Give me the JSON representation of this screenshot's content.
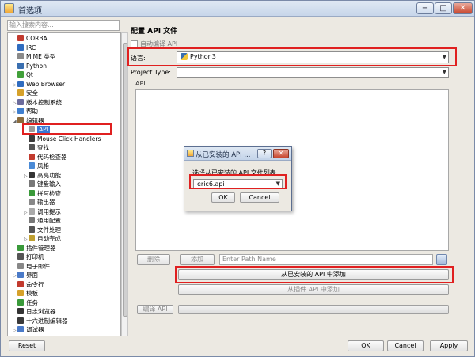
{
  "window": {
    "title": "首选项",
    "min": "−",
    "max": "□",
    "close": "✕"
  },
  "sidebar": {
    "search_placeholder": "输入搜索内容...",
    "items": [
      {
        "label": "CORBA",
        "indent": 1,
        "icon_color": "#c23a2e"
      },
      {
        "label": "IRC",
        "indent": 1,
        "icon_color": "#2f6cc0"
      },
      {
        "label": "MIME 类型",
        "indent": 1,
        "icon_color": "#8a8a8a"
      },
      {
        "label": "Python",
        "indent": 1,
        "icon_color": "#3a6fb0"
      },
      {
        "label": "Qt",
        "indent": 1,
        "icon_color": "#41a03a"
      },
      {
        "label": "Web Browser",
        "indent": 1,
        "arrow": "▷",
        "icon_color": "#2f6cc0"
      },
      {
        "label": "安全",
        "indent": 1,
        "icon_color": "#d6a12a"
      },
      {
        "label": "版本控制系统",
        "indent": 1,
        "arrow": "▷",
        "icon_color": "#6b6b9c"
      },
      {
        "label": "帮助",
        "indent": 1,
        "arrow": "▷",
        "icon_color": "#3f7fcf"
      },
      {
        "label": "编辑器",
        "indent": 1,
        "arrow": "◢",
        "icon_color": "#8a6b3c"
      },
      {
        "label": "API",
        "indent": 2,
        "icon_color": "#9a9a9a",
        "selected": true
      },
      {
        "label": "Mouse Click Handlers",
        "indent": 2,
        "icon_color": "#3a3a3a"
      },
      {
        "label": "查找",
        "indent": 2,
        "icon_color": "#555555"
      },
      {
        "label": "代码检查器",
        "indent": 2,
        "icon_color": "#c23a2e"
      },
      {
        "label": "风格",
        "indent": 2,
        "icon_color": "#4a8ad6"
      },
      {
        "label": "高亮功能",
        "indent": 2,
        "arrow": "▷",
        "icon_color": "#333333"
      },
      {
        "label": "键盘输入",
        "indent": 2,
        "icon_color": "#777777"
      },
      {
        "label": "拼写检查",
        "indent": 2,
        "icon_color": "#3a9a3a"
      },
      {
        "label": "输出器",
        "indent": 2,
        "icon_color": "#888888"
      },
      {
        "label": "调用提示",
        "indent": 2,
        "arrow": "▷",
        "icon_color": "#aaaaaa"
      },
      {
        "label": "通用配置",
        "indent": 2,
        "icon_color": "#777777"
      },
      {
        "label": "文件处理",
        "indent": 2,
        "icon_color": "#555555"
      },
      {
        "label": "自动完成",
        "indent": 2,
        "arrow": "▷",
        "icon_color": "#c0a030"
      },
      {
        "label": "插件管理器",
        "indent": 1,
        "icon_color": "#3a9a3a"
      },
      {
        "label": "打印机",
        "indent": 1,
        "icon_color": "#555555"
      },
      {
        "label": "电子邮件",
        "indent": 1,
        "icon_color": "#888888"
      },
      {
        "label": "界面",
        "indent": 1,
        "arrow": "▷",
        "icon_color": "#4a7ac8"
      },
      {
        "label": "命令行",
        "indent": 1,
        "icon_color": "#c23a2e"
      },
      {
        "label": "模板",
        "indent": 1,
        "icon_color": "#d6a12a"
      },
      {
        "label": "任务",
        "indent": 1,
        "icon_color": "#3a9a3a"
      },
      {
        "label": "日志浏览器",
        "indent": 1,
        "icon_color": "#333333"
      },
      {
        "label": "十六进制编辑器",
        "indent": 1,
        "icon_color": "#3a3a3a"
      },
      {
        "label": "调试器",
        "indent": 1,
        "arrow": "▷",
        "icon_color": "#4a7ac8"
      }
    ]
  },
  "main": {
    "title": "配置 API 文件",
    "compile_checkbox": "自动编译 API",
    "language_label": "语言:",
    "language_value": "Python3",
    "project_type_label": "Project Type:",
    "project_type_value": "",
    "api_label": "API",
    "delete_button": "删除",
    "add_button": "添加",
    "path_placeholder": "Enter Path Name",
    "add_installed_button": "从已安装的 API 中添加",
    "add_plugin_button": "从插件 API 中添加",
    "compile_button": "编译 API"
  },
  "dialog": {
    "title": "从已安装的 API ...",
    "help": "?",
    "close": "✕",
    "prompt": "选择从已安装的 API 文件列表",
    "selected": "eric6.api",
    "ok": "OK",
    "cancel": "Cancel"
  },
  "footer": {
    "reset": "Reset",
    "ok": "OK",
    "cancel": "Cancel",
    "apply": "Apply"
  },
  "accent_red": "#e02020",
  "selection_color": "#3a78d4"
}
